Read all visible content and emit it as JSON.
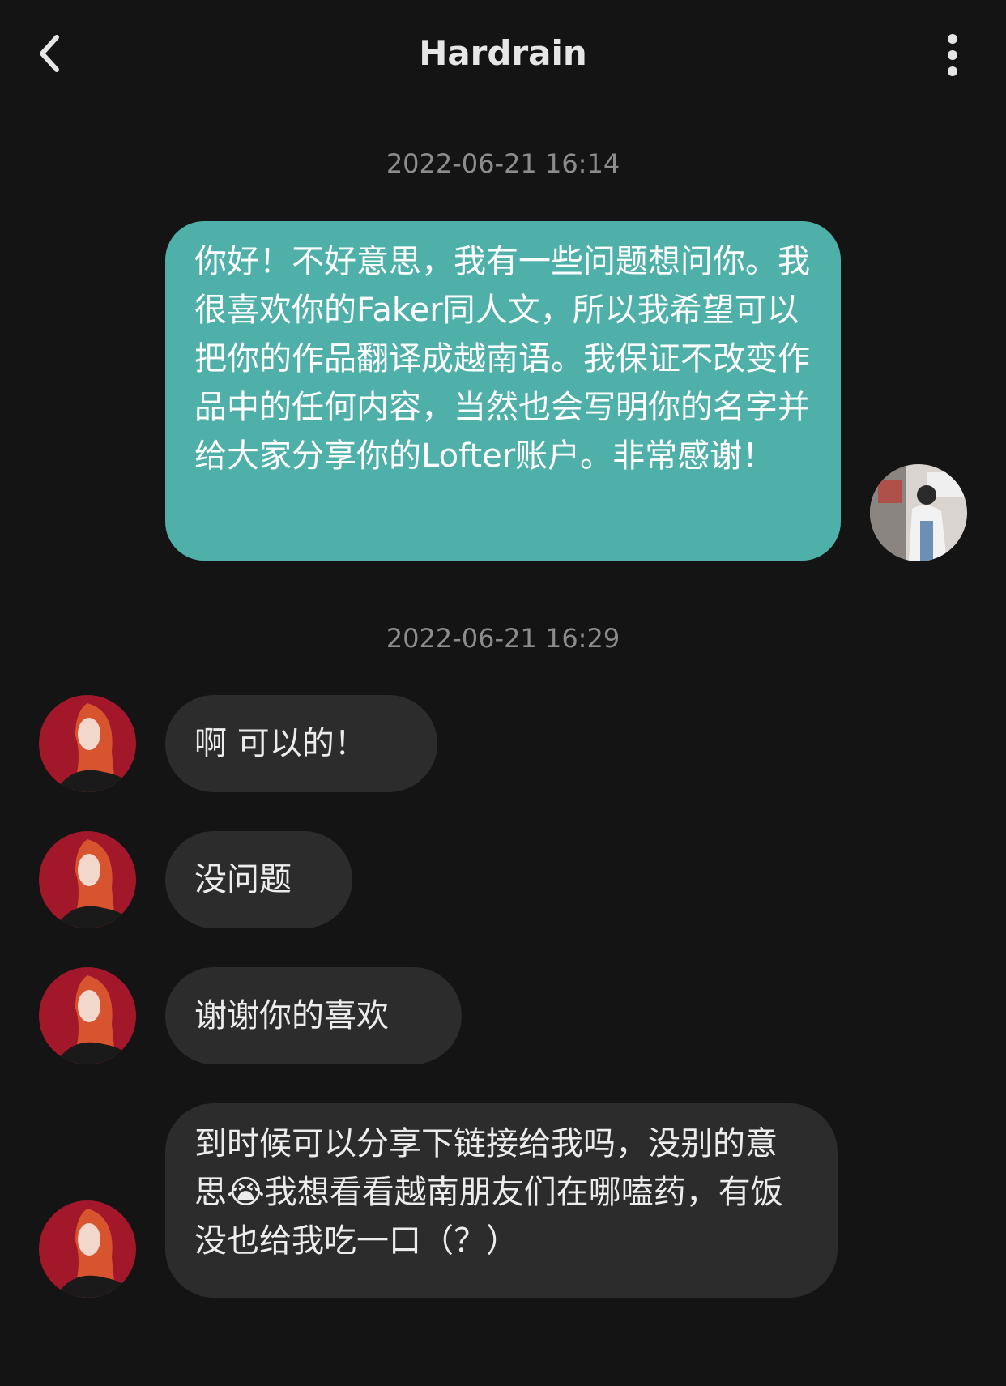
{
  "header": {
    "title": "Hardrain",
    "back_icon": "chevron-left-icon",
    "more_icon": "more-vertical-icon"
  },
  "colors": {
    "background": "#141414",
    "outgoing_bubble": "#4fb0aa",
    "incoming_bubble": "#2c2c2c",
    "timestamp_text": "#8c8c8c"
  },
  "messages": {
    "timestamp_1": "2022-06-21 16:14",
    "outgoing_1": "你好！不好意思，我有一些问题想问你。我很喜欢你的Faker同人文，所以我希望可以把你的作品翻译成越南语。我保证不改变作品中的任何内容，当然也会写明你的名字并给大家分享你的Lofter账户。非常感谢！",
    "timestamp_2": "2022-06-21 16:29",
    "incoming_1": "啊 可以的！",
    "incoming_2": "没问题",
    "incoming_3": "谢谢你的喜欢",
    "incoming_4": "到时候可以分享下链接给我吗，没别的意思😭我想看看越南朋友们在哪嗑药，有饭没也给我吃一口（？）"
  }
}
